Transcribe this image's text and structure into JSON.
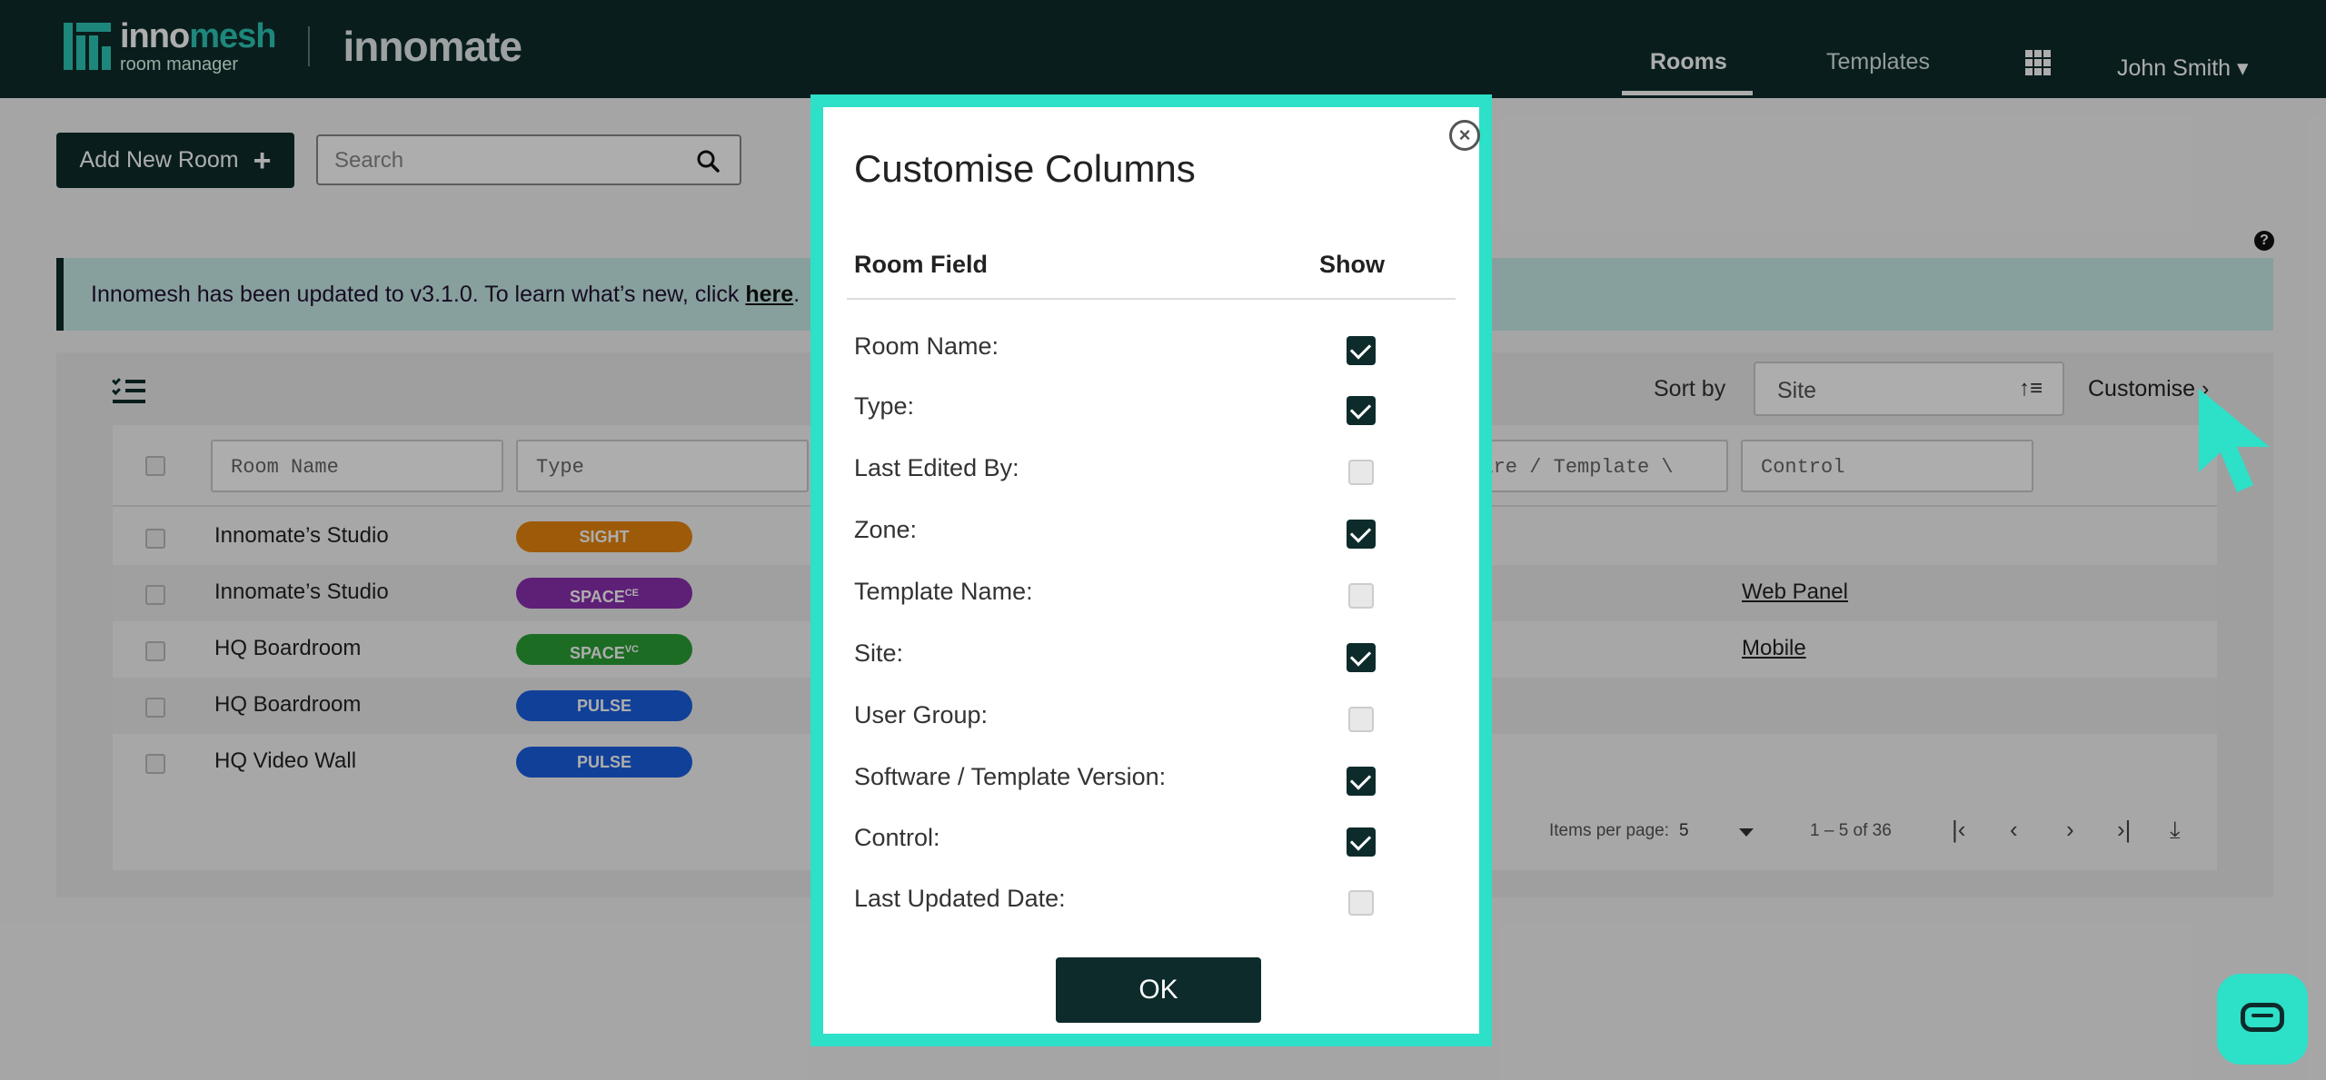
{
  "brand": {
    "name_a": "inno",
    "name_b": "mesh",
    "sub": "room manager",
    "app": "innomate"
  },
  "nav": {
    "rooms": "Rooms",
    "templates": "Templates",
    "user": "John Smith ▾"
  },
  "toolbar": {
    "add_room": "Add New Room",
    "search_placeholder": "Search"
  },
  "banner": {
    "text": "Innomesh has been updated to v3.1.0. To learn what’s new, click ",
    "link": "here",
    "tail": "."
  },
  "sort": {
    "label": "Sort by",
    "value": "Site",
    "customise": "Customise ›"
  },
  "table": {
    "filters": [
      "Room Name",
      "Type",
      "tware / Template \\",
      "Control"
    ],
    "rows": [
      {
        "name": "Innomate’s Studio",
        "type": "SIGHT",
        "type_sup": "",
        "color": "#e8850e",
        "control": ""
      },
      {
        "name": "Innomate’s Studio",
        "type": "SPACE",
        "type_sup": "CE",
        "color": "#8b2fb0",
        "control": "Web Panel"
      },
      {
        "name": "HQ Boardroom",
        "type": "SPACE",
        "type_sup": "VC",
        "color": "#2aa035",
        "control": "Mobile"
      },
      {
        "name": "HQ Boardroom",
        "type": "PULSE",
        "type_sup": "",
        "color": "#1a5fe0",
        "control": ""
      },
      {
        "name": "HQ Video Wall",
        "type": "PULSE",
        "type_sup": "",
        "color": "#1a5fe0",
        "control": ""
      }
    ],
    "items_per_page_label": "Items per page:",
    "items_per_page": "5",
    "range": "1 – 5 of 36"
  },
  "modal": {
    "title": "Customise Columns",
    "col_field": "Room Field",
    "col_show": "Show",
    "fields": [
      {
        "label": "Room Name:",
        "checked": true
      },
      {
        "label": "Type:",
        "checked": true
      },
      {
        "label": "Last Edited By:",
        "checked": false
      },
      {
        "label": "Zone:",
        "checked": true
      },
      {
        "label": "Template Name:",
        "checked": false
      },
      {
        "label": "Site:",
        "checked": true
      },
      {
        "label": "User Group:",
        "checked": false
      },
      {
        "label": "Software / Template Version:",
        "checked": true
      },
      {
        "label": "Control:",
        "checked": true
      },
      {
        "label": "Last Updated Date:",
        "checked": false
      }
    ],
    "ok": "OK"
  },
  "colors": {
    "brand_dark": "#0e2b2b",
    "accent": "#2de0c8"
  }
}
